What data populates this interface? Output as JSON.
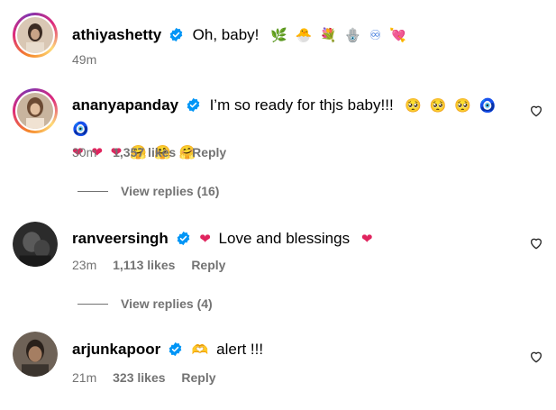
{
  "comments": [
    {
      "username": "athiyashetty",
      "text": "Oh, baby!",
      "emojis": [
        "🌿",
        "🐣",
        "💐",
        "🪬",
        "♾",
        "💘"
      ],
      "time": "49m"
    },
    {
      "username": "ananyapanday",
      "text": "I’m so ready for thjs baby!!!",
      "emojis": [
        "🥺",
        "🥺",
        "🥺",
        "🧿",
        "🧿",
        "❤",
        "❤",
        "❤",
        "🤗",
        "🤗",
        "🤗"
      ],
      "time": "30m",
      "likes": "1,357 likes",
      "reply": "Reply",
      "view_replies": "View replies (16)"
    },
    {
      "username": "ranveersingh",
      "pre_emoji": "❤",
      "text": "Love and blessings",
      "emojis": [
        "❤"
      ],
      "time": "23m",
      "likes": "1,113 likes",
      "reply": "Reply",
      "view_replies": "View replies (4)"
    },
    {
      "username": "arjunkapoor",
      "pre_emoji": "🫶",
      "text": "alert !!!",
      "emojis": [],
      "time": "21m",
      "likes": "323 likes",
      "reply": "Reply"
    }
  ],
  "colors": {
    "verified": "#0095f6",
    "heart": "#e0245e",
    "meta": "#737373"
  },
  "icons": {
    "verified": "verified-badge-icon",
    "like": "heart-outline-icon"
  }
}
